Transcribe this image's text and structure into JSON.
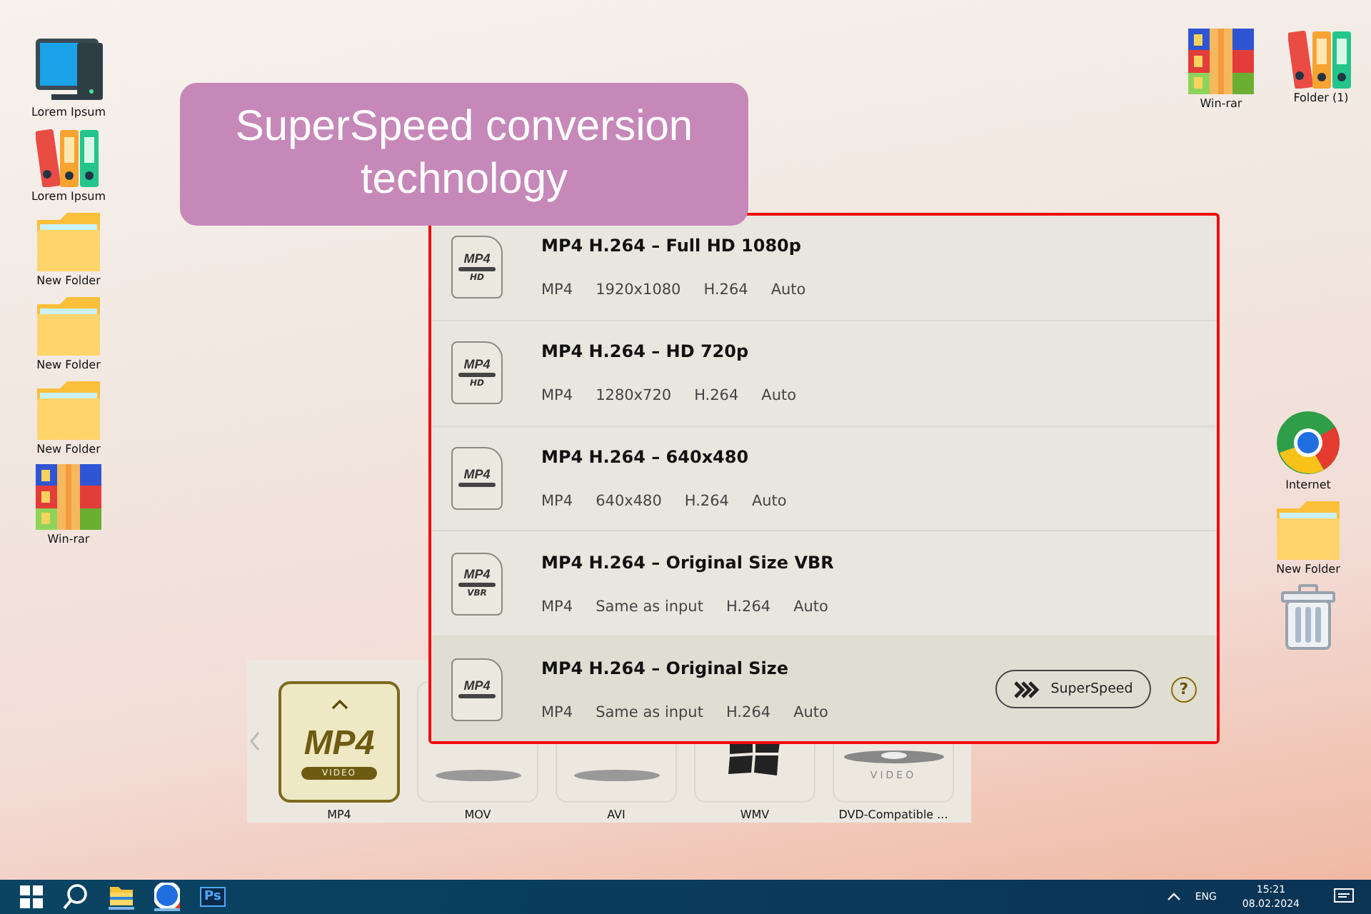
{
  "left_icons": [
    {
      "kind": "computer",
      "label": "Lorem Ipsum"
    },
    {
      "kind": "binders",
      "label": "Lorem Ipsum"
    },
    {
      "kind": "folder",
      "label": "New Folder"
    },
    {
      "kind": "folder",
      "label": "New Folder"
    },
    {
      "kind": "folder",
      "label": "New Folder"
    },
    {
      "kind": "archive",
      "label": "Win-rar"
    }
  ],
  "top_right_icons": [
    {
      "kind": "archive",
      "label": "Win-rar"
    },
    {
      "kind": "binders",
      "label": "Folder (1)"
    }
  ],
  "right_icons": [
    {
      "kind": "browser",
      "label": "Internet"
    },
    {
      "kind": "folder",
      "label": "New Folder"
    },
    {
      "kind": "trash"
    }
  ],
  "callout": {
    "text": "SuperSpeed conversion technology"
  },
  "formats": [
    {
      "kind": "mp4",
      "label": "MP4",
      "logo": "MP4",
      "pill": "VIDEO",
      "selected": true
    },
    {
      "kind": "pill",
      "label": "MOV",
      "selected": false
    },
    {
      "kind": "pill",
      "label": "AVI",
      "selected": false
    },
    {
      "kind": "windows",
      "label": "WMV",
      "selected": false
    },
    {
      "kind": "disc",
      "label": "DVD-Compatible ...",
      "pill": "VIDEO",
      "selected": false
    }
  ],
  "presets": [
    {
      "icon_text": "MP4",
      "badge": "HD",
      "title": "MP4 H.264 – Full HD 1080p",
      "specs": [
        "MP4",
        "1920x1080",
        "H.264",
        "Auto"
      ],
      "selected": false
    },
    {
      "icon_text": "MP4",
      "badge": "HD",
      "title": "MP4 H.264 – HD 720p",
      "specs": [
        "MP4",
        "1280x720",
        "H.264",
        "Auto"
      ],
      "selected": false
    },
    {
      "icon_text": "MP4",
      "title": "MP4 H.264 – 640x480",
      "specs": [
        "MP4",
        "640x480",
        "H.264",
        "Auto"
      ],
      "selected": false
    },
    {
      "icon_text": "MP4",
      "badge": "VBR",
      "title": "MP4 H.264 – Original Size VBR",
      "specs": [
        "MP4",
        "Same as input",
        "H.264",
        "Auto"
      ],
      "selected": false
    },
    {
      "icon_text": "MP4",
      "title": "MP4 H.264 – Original Size",
      "specs": [
        "MP4",
        "Same as input",
        "H.264",
        "Auto"
      ],
      "selected": true,
      "superspeed_button": "SuperSpeed",
      "help": "?"
    }
  ],
  "taskbar": {
    "ps_label": "Ps",
    "language": "ENG",
    "time": "15:21",
    "date": "08.02.2024"
  }
}
